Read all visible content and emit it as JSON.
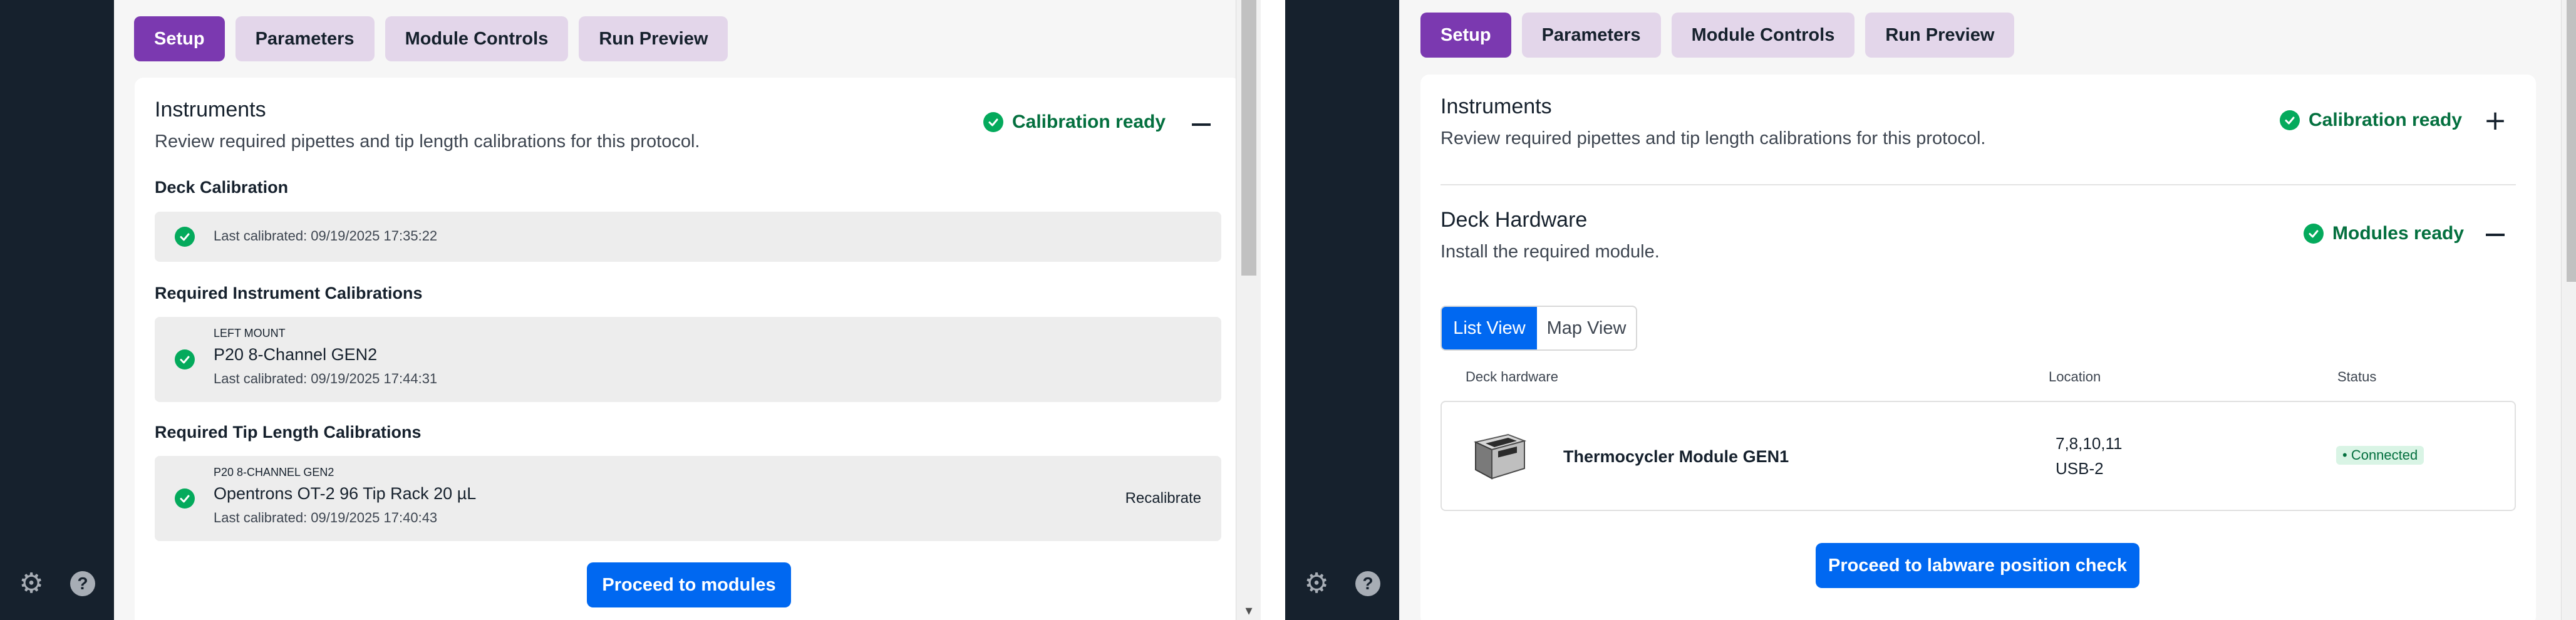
{
  "left": {
    "tabs": [
      {
        "label": "Setup",
        "active": true
      },
      {
        "label": "Parameters",
        "active": false
      },
      {
        "label": "Module Controls",
        "active": false
      },
      {
        "label": "Run Preview",
        "active": false
      }
    ],
    "instruments": {
      "title": "Instruments",
      "subtitle": "Review required pipettes and tip length calibrations for this protocol.",
      "status": "Calibration ready",
      "deck_calibration": {
        "heading": "Deck Calibration",
        "last_calibrated": "Last calibrated: 09/19/2025 17:35:22"
      },
      "instrument_calibrations": {
        "heading": "Required Instrument Calibrations",
        "mount": "LEFT MOUNT",
        "name": "P20 8-Channel GEN2",
        "last_calibrated": "Last calibrated: 09/19/2025 17:44:31"
      },
      "tip_length_calibrations": {
        "heading": "Required Tip Length Calibrations",
        "mount": "P20 8-CHANNEL GEN2",
        "name": "Opentrons OT-2 96 Tip Rack 20 µL",
        "last_calibrated": "Last calibrated: 09/19/2025 17:40:43",
        "action": "Recalibrate"
      }
    },
    "proceed_button": "Proceed to modules"
  },
  "right": {
    "tabs": [
      {
        "label": "Setup",
        "active": true
      },
      {
        "label": "Parameters",
        "active": false
      },
      {
        "label": "Module Controls",
        "active": false
      },
      {
        "label": "Run Preview",
        "active": false
      }
    ],
    "instruments": {
      "title": "Instruments",
      "subtitle": "Review required pipettes and tip length calibrations for this protocol.",
      "status": "Calibration ready"
    },
    "deck_hardware": {
      "title": "Deck Hardware",
      "subtitle": "Install the required module.",
      "status": "Modules ready",
      "view_toggle": {
        "list": "List View",
        "map": "Map View",
        "selected": "List View"
      },
      "columns": {
        "hardware": "Deck hardware",
        "location": "Location",
        "status": "Status"
      },
      "rows": [
        {
          "name": "Thermocycler Module GEN1",
          "location_slots": "7,8,10,11",
          "location_port": "USB-2",
          "status": "• Connected"
        }
      ]
    },
    "proceed_button": "Proceed to labware position check"
  },
  "icons": {
    "settings": "gear-icon",
    "help": "help-icon",
    "check": "check-circle-icon",
    "collapse": "minus-icon",
    "expand": "plus-icon"
  },
  "colors": {
    "nav_background": "#16212d",
    "tab_active": "#7b39b0",
    "tab_inactive": "#e3d6ea",
    "primary_button": "#0068f1",
    "success_text": "#04703f",
    "success_icon": "#04aa5c",
    "page_background": "#f6f6f6"
  }
}
